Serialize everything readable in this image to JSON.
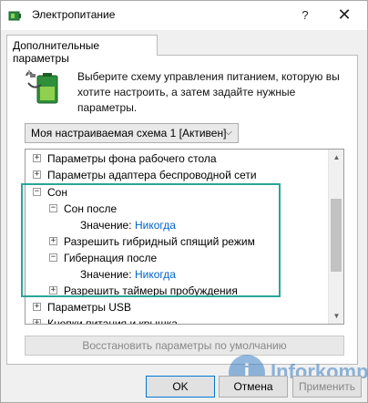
{
  "window": {
    "title": "Электропитание",
    "help_glyph": "?",
    "close_glyph": "✕",
    "icon": "power-options-icon"
  },
  "tab": {
    "label": "Дополнительные параметры"
  },
  "intro": {
    "icon": "battery-plug-icon",
    "text": "Выберите схему управления питанием, которую вы хотите настроить, а затем задайте нужные параметры."
  },
  "scheme_select": {
    "value": "Моя настраиваемая схема 1 [Активен]",
    "chevron": "⌵"
  },
  "tree": {
    "items": [
      {
        "expander": "+",
        "label": "Параметры фона рабочего стола"
      },
      {
        "expander": "+",
        "label": "Параметры адаптера беспроводной сети"
      },
      {
        "expander": "−",
        "label": "Сон"
      },
      {
        "expander": "−",
        "label": "Сон после"
      },
      {
        "value_label": "Значение:",
        "value": "Никогда"
      },
      {
        "expander": "+",
        "label": "Разрешить гибридный спящий режим"
      },
      {
        "expander": "−",
        "label": "Гибернация после"
      },
      {
        "value_label": "Значение:",
        "value": "Никогда"
      },
      {
        "expander": "+",
        "label": "Разрешить таймеры пробуждения"
      },
      {
        "expander": "+",
        "label": "Параметры USB"
      },
      {
        "expander": "+",
        "label": "Кнопки питания и крышка"
      }
    ],
    "scroll_up": "▲",
    "scroll_down": "▼"
  },
  "restore_button": {
    "label": "Восстановить параметры по умолчанию"
  },
  "buttons": {
    "ok": "OK",
    "cancel": "Отмена",
    "apply": "Применить"
  },
  "watermark": {
    "letter": "i",
    "text": "Inforkomp"
  },
  "colors": {
    "highlight": "#2aa597",
    "link": "#0066cc",
    "watermark": "#3a7fc4"
  }
}
